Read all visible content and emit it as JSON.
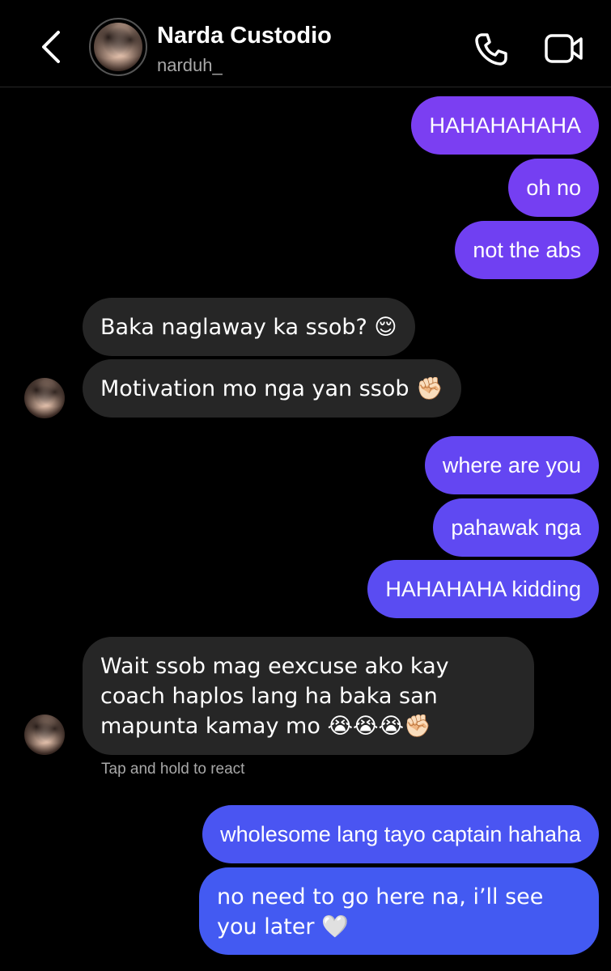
{
  "header": {
    "name": "Narda Custodio",
    "username": "narduh_",
    "icons": {
      "back": "chevron-left-icon",
      "call": "phone-icon",
      "video": "video-camera-icon"
    }
  },
  "colors": {
    "background": "#000000",
    "received_bubble": "#262626",
    "sent_gradient_top": "#7b3ff2",
    "sent_gradient_bottom": "#3e5bf2",
    "secondary_text": "#a8a8a8"
  },
  "messages": [
    {
      "side": "sent",
      "text": "HAHAHAHAHA"
    },
    {
      "side": "sent",
      "text": "oh no"
    },
    {
      "side": "sent",
      "text": "not the abs"
    },
    {
      "side": "received",
      "text": "Baka naglaway ka ssob? 😌"
    },
    {
      "side": "received",
      "text": "Motivation mo nga yan ssob ✊🏻"
    },
    {
      "side": "sent",
      "text": "where are you"
    },
    {
      "side": "sent",
      "text": "pahawak nga"
    },
    {
      "side": "sent",
      "text": "HAHAHAHA kidding"
    },
    {
      "side": "received",
      "text": "Wait ssob mag eexcuse ako kay coach haplos lang ha baka san mapunta kamay mo 😭😭😭✊🏻"
    },
    {
      "side": "sent",
      "text": "wholesome lang tayo captain hahaha"
    },
    {
      "side": "sent",
      "text": "no need to go here na, i’ll see you later 🤍"
    }
  ],
  "hint": "Tap and hold to react"
}
